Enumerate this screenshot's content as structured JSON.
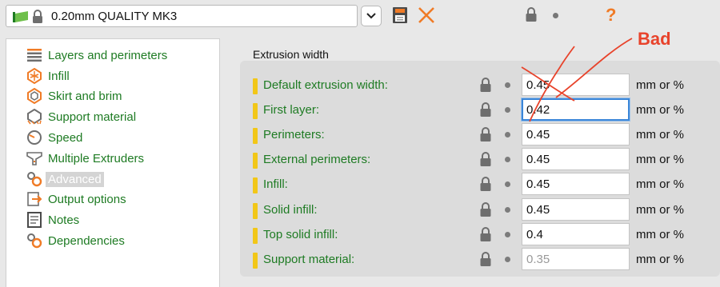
{
  "preset": {
    "name": "0.20mm QUALITY MK3"
  },
  "toolbar": {
    "dropdown_icon": "chevron-down-icon",
    "save_icon": "save-icon",
    "delete_icon": "close-icon",
    "help_label": "?"
  },
  "colors": {
    "accent_green": "#1e7b23",
    "accent_orange": "#f07b26",
    "marker_yellow": "#f2c718",
    "annotation_red": "#e8432b",
    "focus_blue": "#3b86d8"
  },
  "sidebar": {
    "items": [
      {
        "label": "Layers and perimeters",
        "icon": "layers-icon",
        "selected": false
      },
      {
        "label": "Infill",
        "icon": "infill-icon",
        "selected": false
      },
      {
        "label": "Skirt and brim",
        "icon": "skirt-icon",
        "selected": false
      },
      {
        "label": "Support material",
        "icon": "support-icon",
        "selected": false
      },
      {
        "label": "Speed",
        "icon": "speed-icon",
        "selected": false
      },
      {
        "label": "Multiple Extruders",
        "icon": "funnel-icon",
        "selected": false
      },
      {
        "label": "Advanced",
        "icon": "gears-icon",
        "selected": true
      },
      {
        "label": "Output options",
        "icon": "output-icon",
        "selected": false
      },
      {
        "label": "Notes",
        "icon": "notes-icon",
        "selected": false
      },
      {
        "label": "Dependencies",
        "icon": "gears-icon",
        "selected": false
      }
    ]
  },
  "section": {
    "title": "Extrusion width",
    "rows": [
      {
        "label": "Default extrusion width:",
        "value": "0.45",
        "unit": "mm or %"
      },
      {
        "label": "First layer:",
        "value": "0.42",
        "unit": "mm or %"
      },
      {
        "label": "Perimeters:",
        "value": "0.45",
        "unit": "mm or %"
      },
      {
        "label": "External perimeters:",
        "value": "0.45",
        "unit": "mm or %"
      },
      {
        "label": "Infill:",
        "value": "0.45",
        "unit": "mm or %"
      },
      {
        "label": "Solid infill:",
        "value": "0.45",
        "unit": "mm or %"
      },
      {
        "label": "Top solid infill:",
        "value": "0.4",
        "unit": "mm or %"
      },
      {
        "label": "Support material:",
        "value": "0.35",
        "unit": "mm or %"
      }
    ]
  },
  "annotation": {
    "text": "Bad"
  }
}
